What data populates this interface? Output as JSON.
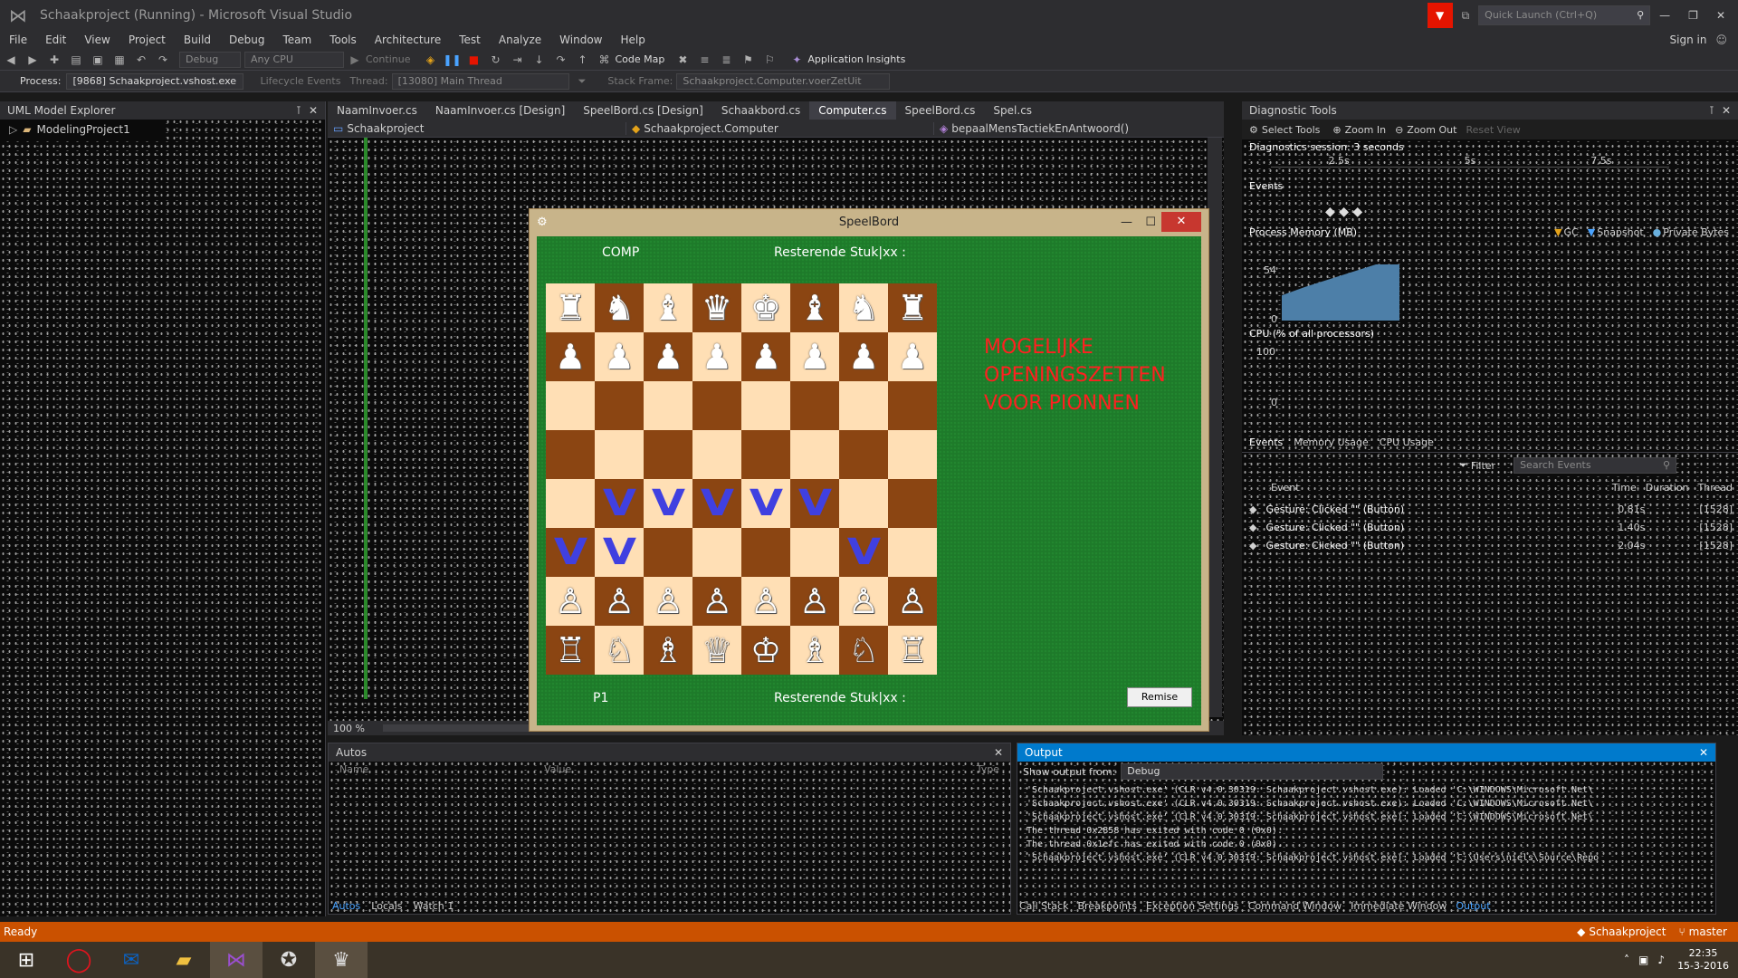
{
  "window": {
    "title": "Schaakproject (Running) - Microsoft Visual Studio",
    "quick_launch": "Quick Launch (Ctrl+Q)",
    "sign_in": "Sign in"
  },
  "menu": [
    "File",
    "Edit",
    "View",
    "Project",
    "Build",
    "Debug",
    "Team",
    "Tools",
    "Architecture",
    "Test",
    "Analyze",
    "Window",
    "Help"
  ],
  "toolbar": {
    "config": "Debug",
    "platform": "Any CPU",
    "continue": "Continue",
    "code_map": "Code Map",
    "app_insights": "Application Insights"
  },
  "debugbar": {
    "process_label": "Process:",
    "process": "[9868] Schaakproject.vshost.exe",
    "lifecycle": "Lifecycle Events",
    "thread_label": "Thread:",
    "thread": "[13080] Main Thread",
    "stack_label": "Stack Frame:",
    "stack": "Schaakproject.Computer.voerZetUit"
  },
  "uml": {
    "title": "UML Model Explorer",
    "item": "ModelingProject1"
  },
  "tabs": [
    "NaamInvoer.cs",
    "NaamInvoer.cs [Design]",
    "SpeelBord.cs [Design]",
    "Schaakbord.cs",
    "Computer.cs",
    "SpeelBord.cs",
    "Spel.cs"
  ],
  "nav": {
    "project": "Schaakproject",
    "class": "Schaakproject.Computer",
    "member": "bepaalMensTactiekEnAntwoord()"
  },
  "zoom": "100 %",
  "speelbord": {
    "title": "SpeelBord",
    "top_player": "COMP",
    "top_remaining": "Resterende Stuk|xx :",
    "bottom_player": "P1",
    "bottom_remaining": "Resterende Stuk|xx :",
    "button": "Remise",
    "note": [
      "MOGELIJKE",
      "OPENINGSZETTEN",
      "VOOR PIONNEN"
    ],
    "board": [
      [
        "♜",
        "♞",
        "♝",
        "♛",
        "♚",
        "♝",
        "♞",
        "♜"
      ],
      [
        "♟",
        "♟",
        "♟",
        "♟",
        "♟",
        "♟",
        "♟",
        "♟"
      ],
      [
        "",
        "",
        "",
        "",
        "",
        "",
        "",
        ""
      ],
      [
        "",
        "",
        "",
        "",
        "",
        "",
        "",
        ""
      ],
      [
        "",
        "V",
        "V",
        "V",
        "V",
        "V",
        "",
        ""
      ],
      [
        "V",
        "V",
        "",
        "",
        "",
        "",
        "V",
        ""
      ],
      [
        "♙",
        "♙",
        "♙",
        "♙",
        "♙",
        "♙",
        "♙",
        "♙"
      ],
      [
        "♖",
        "♘",
        "♗",
        "♕",
        "♔",
        "♗",
        "♘",
        "♖"
      ]
    ]
  },
  "diag": {
    "title": "Diagnostic Tools",
    "select_tools": "Select Tools",
    "zoom_in": "Zoom In",
    "zoom_out": "Zoom Out",
    "reset_view": "Reset View",
    "session": "Diagnostics session: 3 seconds",
    "ticks": [
      "2.5s",
      "5s",
      "7.5s"
    ],
    "events_label": "Events",
    "memory_label": "Process Memory (MB)",
    "gc": "GC",
    "snapshot": "Snapshot",
    "private_bytes": "Private Bytes",
    "mem_max": "54",
    "mem_min": "0",
    "cpu_label": "CPU (% of all processors)",
    "cpu_max": "100",
    "cpu_min": "0",
    "tabs": [
      "Events",
      "Memory Usage",
      "CPU Usage"
    ],
    "filter": "Filter",
    "search": "Search Events",
    "cols": [
      "Event",
      "Time",
      "Duration",
      "Thread"
    ],
    "events": [
      {
        "event": "Gesture: Clicked \"\" (Button)",
        "time": "0.81s",
        "thread": "[1528]"
      },
      {
        "event": "Gesture: Clicked \"\" (Button)",
        "time": "1.40s",
        "thread": "[1528]"
      },
      {
        "event": "Gesture: Clicked \"\" (Button)",
        "time": "2.04s",
        "thread": "[1528]"
      }
    ]
  },
  "autos": {
    "title": "Autos",
    "cols": [
      "Name",
      "Value",
      "Type"
    ],
    "tabs": [
      "Autos",
      "Locals",
      "Watch 1"
    ]
  },
  "output": {
    "title": "Output",
    "show_from_label": "Show output from:",
    "show_from": "Debug",
    "lines": [
      "'Schaakproject.vshost.exe' (CLR v4.0.30319: Schaakproject.vshost.exe): Loaded 'C:\\WINDOWS\\Microsoft.Net\\",
      "'Schaakproject.vshost.exe' (CLR v4.0.30319: Schaakproject.vshost.exe): Loaded 'C:\\WINDOWS\\Microsoft.Net\\",
      "'Schaakproject.vshost.exe' (CLR v4.0.30319: Schaakproject.vshost.exe): Loaded 'C:\\WINDOWS\\Microsoft.Net\\",
      "The thread 0x2858 has exited with code 0 (0x0).",
      "The thread 0x1efc has exited with code 0 (0x0).",
      "'Schaakproject.vshost.exe' (CLR v4.0.30319: Schaakproject.vshost.exe): Loaded 'C:\\Users\\niels\\Source\\Repo"
    ],
    "tabs": [
      "Call Stack",
      "Breakpoints",
      "Exception Settings",
      "Command Window",
      "Immediate Window",
      "Output"
    ]
  },
  "status": {
    "left": "Ready",
    "project": "Schaakproject",
    "branch": "master"
  },
  "taskbar": {
    "time": "22:35",
    "date": "15-3-2016"
  }
}
